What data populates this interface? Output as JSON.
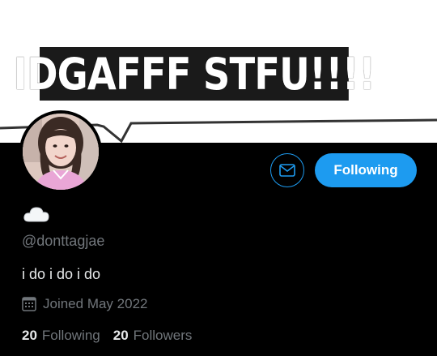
{
  "banner": {
    "text": "IDGAFFF STFU!!!!"
  },
  "actions": {
    "message_icon": "envelope-icon",
    "follow_label": "Following"
  },
  "profile": {
    "display_name_icon": "cloud-icon",
    "handle": "@donttagjae",
    "bio": "i do i do i do",
    "joined_icon": "calendar-icon",
    "joined": "Joined May 2022"
  },
  "stats": {
    "following_count": "20",
    "following_label": "Following",
    "followers_count": "20",
    "followers_label": "Followers"
  },
  "colors": {
    "accent": "#1d9bf0",
    "background": "#000000",
    "secondary_text": "#71767b",
    "primary_text": "#e7e9ea"
  }
}
